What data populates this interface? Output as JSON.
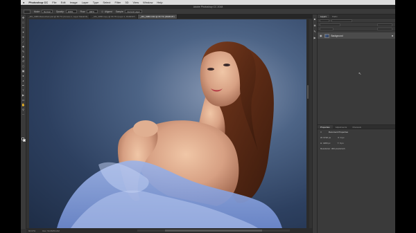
{
  "menubar": {
    "apple": "",
    "app_name": "Photoshop CC",
    "items": [
      "File",
      "Edit",
      "Image",
      "Layer",
      "Type",
      "Select",
      "Filter",
      "3D",
      "View",
      "Window",
      "Help"
    ],
    "window_title": "Adobe Photoshop CC 2018"
  },
  "options": {
    "mode_label": "Mode:",
    "mode_value": "Normal",
    "opacity_label": "Opacity:",
    "opacity_value": "100%",
    "flow_label": "Flow:",
    "flow_value": "100%",
    "aligned_label": "Aligned",
    "sample_label": "Sample:",
    "sample_value": "Current Layer"
  },
  "tabs": [
    "_MG_9080-Retouched.psd @ 66.7% (Curves 1, Layer Mask/16)",
    "_MG_9080 copy @ 66.7% (Layer 1, RGB/16*)",
    "_MG_9080.CR2 @ 66.7% (RGB/16*)"
  ],
  "active_tab": 2,
  "status": {
    "zoom": "66.67%",
    "doc": "Doc: 54.0M/54.0M"
  },
  "panels": {
    "top_tabs": [
      "Layers",
      "Paths"
    ],
    "layer_name": "Background",
    "bottom_tabs": [
      "Properties",
      "Adjustments",
      "Channels"
    ],
    "props_title": "Document Properties",
    "width_label": "W: 6720 px",
    "height_label": "H: 4480 px",
    "x_label": "X: 0 px",
    "y_label": "Y: 0 px",
    "resolution": "Resolution: 300 pixels/inch"
  },
  "colors": {
    "fg": "#000000",
    "bg": "#ffffff"
  }
}
